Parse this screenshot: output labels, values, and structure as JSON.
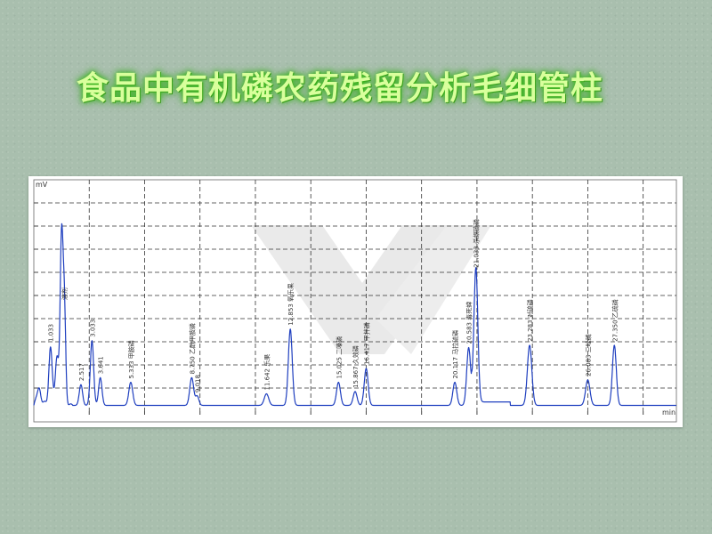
{
  "slide": {
    "title": "食品中有机磷农药残留分析毛细管柱"
  },
  "colors": {
    "title": "#d9ff9c",
    "title_glow": "#3fbf1f",
    "trace": "#1f3fbf",
    "grid": "#333333",
    "background": "#a9bfae"
  },
  "chart_data": {
    "type": "line",
    "title": "",
    "y_unit": "mV",
    "x_unit": "min",
    "xlim": [
      0,
      11.6
    ],
    "ylim": [
      0,
      10
    ],
    "grid": true,
    "legend": "none",
    "baseline": 0.25,
    "peaks": [
      {
        "rt": 0.1,
        "height": 0.9,
        "width": 0.03,
        "label": ""
      },
      {
        "rt": 0.3,
        "height": 2.6,
        "width": 0.03,
        "label": "1.033"
      },
      {
        "rt": 0.42,
        "height": 2.2,
        "width": 0.03,
        "label": ""
      },
      {
        "rt": 0.5,
        "height": 7.0,
        "width": 0.025,
        "label": ""
      },
      {
        "rt": 0.55,
        "height": 4.4,
        "width": 0.025,
        "label": "溶剂"
      },
      {
        "rt": 0.85,
        "height": 0.9,
        "width": 0.03,
        "label": "2.517"
      },
      {
        "rt": 1.05,
        "height": 2.8,
        "width": 0.03,
        "label": "3.033"
      },
      {
        "rt": 1.2,
        "height": 1.2,
        "width": 0.03,
        "label": "3.641"
      },
      {
        "rt": 1.75,
        "height": 1.0,
        "width": 0.035,
        "label": "5.333 甲胺磷"
      },
      {
        "rt": 2.85,
        "height": 1.2,
        "width": 0.035,
        "label": "8.750 乙酰甲胺磷"
      },
      {
        "rt": 2.95,
        "height": 0.4,
        "width": 0.03,
        "label": "9.018"
      },
      {
        "rt": 4.2,
        "height": 0.5,
        "width": 0.04,
        "label": "11.642 乐果"
      },
      {
        "rt": 4.63,
        "height": 3.3,
        "width": 0.035,
        "label": "12.853 氧乐果"
      },
      {
        "rt": 5.5,
        "height": 1.0,
        "width": 0.035,
        "label": "15.025 二嗪磷"
      },
      {
        "rt": 5.8,
        "height": 0.6,
        "width": 0.035,
        "label": "15.867 久效磷"
      },
      {
        "rt": 6.0,
        "height": 1.6,
        "width": 0.035,
        "label": "16.417 甲拌磷"
      },
      {
        "rt": 7.6,
        "height": 1.0,
        "width": 0.035,
        "label": "20.117 马拉硫磷"
      },
      {
        "rt": 7.85,
        "height": 2.5,
        "width": 0.035,
        "label": "20.583 毒死蜱"
      },
      {
        "rt": 7.98,
        "height": 5.8,
        "width": 0.035,
        "label": "21.033 杀螟硫磷"
      },
      {
        "rt": 8.95,
        "height": 2.6,
        "width": 0.04,
        "label": "23.283 对硫磷"
      },
      {
        "rt": 10.0,
        "height": 1.1,
        "width": 0.04,
        "label": "26.083 三唑磷"
      },
      {
        "rt": 10.48,
        "height": 2.6,
        "width": 0.035,
        "label": "27.350 乙硫磷"
      }
    ]
  }
}
